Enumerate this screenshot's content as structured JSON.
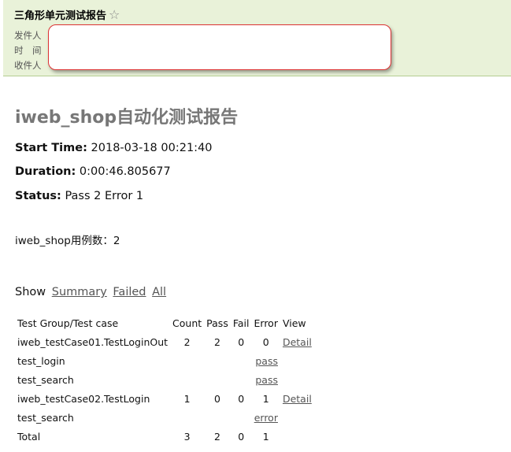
{
  "mail": {
    "subject": "三角形单元测试报告",
    "star_glyph": "☆",
    "labels": {
      "from": "发件人",
      "time": "时　间",
      "to": "收件人"
    }
  },
  "report": {
    "title": "iweb_shop自动化测试报告",
    "start_time_label": "Start Time:",
    "start_time": "2018-03-18 00:21:40",
    "duration_label": "Duration:",
    "duration": "0:00:46.805677",
    "status_label": "Status:",
    "status": "Pass 2 Error 1",
    "case_count_text": "iweb_shop用例数：2"
  },
  "filters": {
    "label": "Show",
    "summary": "Summary",
    "failed": "Failed",
    "all": "All"
  },
  "table": {
    "headers": [
      "Test Group/Test case",
      "Count",
      "Pass",
      "Fail",
      "Error",
      "View"
    ],
    "rows": [
      {
        "name": "iweb_testCase01.TestLoginOut",
        "count": "2",
        "pass": "2",
        "fail": "0",
        "error": "0",
        "view": "Detail"
      },
      {
        "name": "test_login",
        "result": "pass"
      },
      {
        "name": "test_search",
        "result": "pass"
      },
      {
        "name": "iweb_testCase02.TestLogin",
        "count": "1",
        "pass": "0",
        "fail": "0",
        "error": "1",
        "view": "Detail"
      },
      {
        "name": "test_search",
        "result": "error"
      },
      {
        "name": "Total",
        "count": "3",
        "pass": "2",
        "fail": "0",
        "error": "1"
      }
    ]
  },
  "colors": {
    "header_bg": "#e9f2d9",
    "redaction_border": "#dd3333",
    "title_gray": "#777777"
  }
}
